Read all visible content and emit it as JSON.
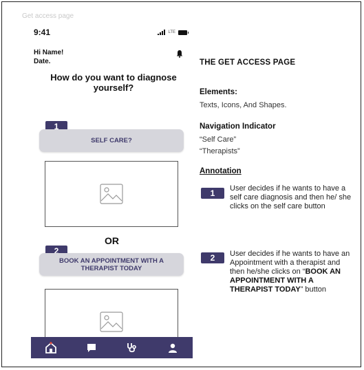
{
  "page_label": "Get access page",
  "phone": {
    "time": "9:41",
    "lte": "LTE",
    "greeting_name": "Hi Name!",
    "greeting_date": "Date.",
    "question": "How do you want to diagnose yourself?",
    "option1": {
      "badge": "1",
      "label": "SELF CARE?"
    },
    "or": "OR",
    "option2": {
      "badge": "2",
      "label": "BOOK AN APPOINTMENT WITH A THERAPIST TODAY"
    },
    "tabs": [
      "home-icon",
      "chat-icon",
      "stethoscope-icon",
      "profile-icon"
    ]
  },
  "panel": {
    "title": "THE GET ACCESS PAGE",
    "elements_heading": "Elements:",
    "elements_text": "Texts, Icons, And Shapes.",
    "nav_heading": "Navigation Indicator",
    "nav_item1": "“Self Care”",
    "nav_item2": "“Therapists”",
    "annotation_heading": "Annotation",
    "note1_badge": "1",
    "note1_text": "User decides if he wants to have a self care diagnosis and then he/ she clicks on the self care button",
    "note2_badge": "2",
    "note2_pre": "User decides if he wants to have an Appointment with a therapist and then he/she clicks on “",
    "note2_bold": "BOOK AN APPOINTMENT WITH A THERAPIST TODAY",
    "note2_post": "” button"
  },
  "colors": {
    "brand": "#3f3a6b",
    "button_bg": "#d6d6dc"
  }
}
